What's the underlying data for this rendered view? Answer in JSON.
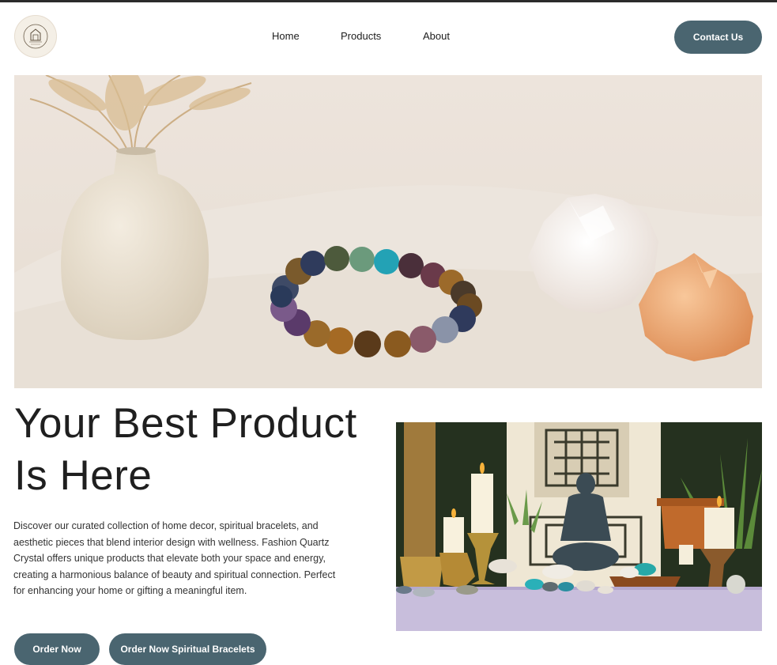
{
  "header": {
    "logo_icon": "brand-logo-icon",
    "nav": [
      {
        "label": "Home"
      },
      {
        "label": "Products"
      },
      {
        "label": "About"
      }
    ],
    "contact_label": "Contact Us"
  },
  "hero": {
    "image_subject": "hero-image"
  },
  "main": {
    "headline": "Your Best Product Is Here",
    "description": "Discover our curated collection of home decor, spiritual bracelets, and aesthetic pieces that blend interior design with wellness. Fashion Quartz Crystal offers unique products that elevate both your space and energy, creating a harmonious balance of beauty and spiritual connection. Perfect for enhancing your home or gifting a meaningful item.",
    "buttons": [
      {
        "label": "Order Now"
      },
      {
        "label": "Order Now Spiritual Bracelets"
      }
    ]
  },
  "colors": {
    "accent": "#4a6570",
    "background": "#ffffff",
    "text": "#1f1f1f"
  }
}
